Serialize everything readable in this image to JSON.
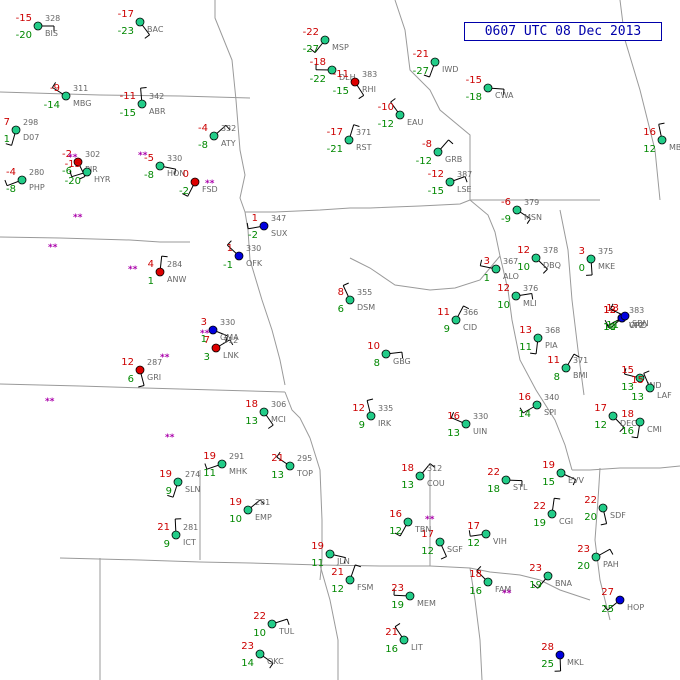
{
  "map_title": "0607 UTC 08 Dec 2013",
  "colors": {
    "temperature": "#cc0000",
    "dewpoint": "#008800",
    "station_id": "#666666",
    "pressure": "#666666",
    "weather": "#aa00aa",
    "sky_clear": "#ffffff",
    "sky_ovc_blue": "#0000dd",
    "sky_ovc_red": "#dd0000",
    "sky_ovc_green": "#22cc88",
    "border": "#999999",
    "title": "#0000aa"
  },
  "stations": [
    {
      "id": "BIS",
      "t": "-15",
      "td": "-20",
      "p": "328",
      "sky": "green"
    },
    {
      "id": "BAC",
      "t": "-17",
      "td": "-23",
      "p": "",
      "sky": "green"
    },
    {
      "id": "D07",
      "t": "7",
      "td": "1",
      "p": "298",
      "sky": "green"
    },
    {
      "id": "PHP",
      "t": "-4",
      "td": "-8",
      "p": "280",
      "sky": "green"
    },
    {
      "id": "MBG",
      "t": "-9",
      "td": "-14",
      "p": "311",
      "sky": "green"
    },
    {
      "id": "ABR",
      "t": "-11",
      "td": "-15",
      "p": "342",
      "sky": "green"
    },
    {
      "id": "ATY",
      "t": "-4",
      "td": "-8",
      "p": "332",
      "sky": "green"
    },
    {
      "id": "HON",
      "t": "-5",
      "td": "-8",
      "p": "330",
      "sky": "green"
    },
    {
      "id": "PIR",
      "t": "-2",
      "td": "-6",
      "p": "302",
      "sky": "red"
    },
    {
      "id": "FSD",
      "t": "0",
      "td": "-2",
      "p": "",
      "sky": "red"
    },
    {
      "id": "SUX",
      "t": "1",
      "td": "-2",
      "p": "347",
      "sky": "blue"
    },
    {
      "id": "OFK",
      "t": "1",
      "td": "-1",
      "p": "330",
      "sky": "blue"
    },
    {
      "id": "ANW",
      "t": "4",
      "td": "1",
      "p": "284",
      "sky": "red"
    },
    {
      "id": "LNK",
      "t": "7",
      "td": "3",
      "p": "312",
      "sky": "red"
    },
    {
      "id": "OMA",
      "t": "3",
      "td": "1",
      "p": "330",
      "sky": "blue"
    },
    {
      "id": "GRI",
      "t": "12",
      "td": "6",
      "p": "287",
      "sky": "red"
    },
    {
      "id": "MSP",
      "t": "-22",
      "td": "-27",
      "p": "",
      "sky": "green"
    },
    {
      "id": "DLH",
      "t": "-18",
      "td": "-22",
      "p": "",
      "sky": "green"
    },
    {
      "id": "EAU",
      "t": "-10",
      "td": "-12",
      "p": "",
      "sky": "green"
    },
    {
      "id": "RST",
      "t": "-17",
      "td": "-21",
      "p": "371",
      "sky": "green"
    },
    {
      "id": "LSE",
      "t": "-12",
      "td": "-15",
      "p": "387",
      "sky": "green"
    },
    {
      "id": "MSN",
      "t": "-6",
      "td": "-9",
      "p": "379",
      "sky": "green"
    },
    {
      "id": "MKE",
      "t": "3",
      "td": "0",
      "p": "375",
      "sky": "green"
    },
    {
      "id": "ORD",
      "t": "12",
      "td": "10",
      "p": "383",
      "sky": "green"
    },
    {
      "id": "ALO",
      "t": "3",
      "td": "1",
      "p": "367",
      "sky": "green"
    },
    {
      "id": "DSM",
      "t": "8",
      "td": "6",
      "p": "355",
      "sky": "green"
    },
    {
      "id": "CID",
      "t": "11",
      "td": "9",
      "p": "366",
      "sky": "green"
    },
    {
      "id": "MLI",
      "t": "12",
      "td": "10",
      "p": "376",
      "sky": "green"
    },
    {
      "id": "DBQ",
      "t": "12",
      "td": "10",
      "p": "378",
      "sky": "green"
    },
    {
      "id": "PIA",
      "t": "13",
      "td": "11",
      "p": "368",
      "sky": "green"
    },
    {
      "id": "SPI",
      "t": "16",
      "td": "14",
      "p": "340",
      "sky": "green"
    },
    {
      "id": "UIN",
      "t": "16",
      "td": "13",
      "p": "330",
      "sky": "green"
    },
    {
      "id": "IRK",
      "t": "12",
      "td": "9",
      "p": "335",
      "sky": "green"
    },
    {
      "id": "COU",
      "t": "18",
      "td": "13",
      "p": "312",
      "sky": "green"
    },
    {
      "id": "STL",
      "t": "22",
      "td": "18",
      "p": "",
      "sky": "green"
    },
    {
      "id": "MCI",
      "t": "18",
      "td": "13",
      "p": "306",
      "sky": "green"
    },
    {
      "id": "SLN",
      "t": "19",
      "td": "9",
      "p": "274",
      "sky": "green"
    },
    {
      "id": "MHK",
      "t": "19",
      "td": "11",
      "p": "291",
      "sky": "green"
    },
    {
      "id": "TOP",
      "t": "21",
      "td": "13",
      "p": "295",
      "sky": "green"
    },
    {
      "id": "ICT",
      "t": "21",
      "td": "9",
      "p": "281",
      "sky": "green"
    },
    {
      "id": "EMP",
      "t": "19",
      "td": "10",
      "p": "281",
      "sky": "green"
    },
    {
      "id": "JLN",
      "t": "19",
      "td": "11",
      "p": "",
      "sky": "green"
    },
    {
      "id": "SGF",
      "t": "17",
      "td": "12",
      "p": "",
      "sky": "green"
    },
    {
      "id": "TBN",
      "t": "16",
      "td": "12",
      "p": "",
      "sky": "green"
    },
    {
      "id": "VIH",
      "t": "17",
      "td": "12",
      "p": "",
      "sky": "green"
    },
    {
      "id": "FAM",
      "t": "18",
      "td": "16",
      "p": "",
      "sky": "green"
    },
    {
      "id": "CGI",
      "t": "22",
      "td": "19",
      "p": "",
      "sky": "green"
    },
    {
      "id": "PAH",
      "t": "23",
      "td": "20",
      "p": "",
      "sky": "green"
    },
    {
      "id": "EVV",
      "t": "19",
      "td": "15",
      "p": "",
      "sky": "green"
    },
    {
      "id": "SDF",
      "t": "22",
      "td": "20",
      "p": "",
      "sky": "green"
    },
    {
      "id": "BNA",
      "t": "23",
      "td": "19",
      "p": "",
      "sky": "green"
    },
    {
      "id": "MEM",
      "t": "23",
      "td": "19",
      "p": "",
      "sky": "green"
    },
    {
      "id": "LIT",
      "t": "21",
      "td": "16",
      "p": "",
      "sky": "green"
    },
    {
      "id": "FSM",
      "t": "21",
      "td": "12",
      "p": "",
      "sky": "green"
    },
    {
      "id": "TUL",
      "t": "22",
      "td": "10",
      "p": "",
      "sky": "green"
    },
    {
      "id": "OKC",
      "t": "23",
      "td": "14",
      "p": "",
      "sky": "green"
    },
    {
      "id": "MKL",
      "t": "28",
      "td": "25",
      "p": "",
      "sky": "blue"
    },
    {
      "id": "HOP",
      "t": "27",
      "td": "25",
      "p": "",
      "sky": "blue"
    },
    {
      "id": "IND",
      "t": "15",
      "td": "13",
      "p": "",
      "sky": "green"
    },
    {
      "id": "LAF",
      "t": "15",
      "td": "13",
      "p": "",
      "sky": "green"
    },
    {
      "id": "BMI",
      "t": "11",
      "td": "8",
      "p": "371",
      "sky": "green"
    },
    {
      "id": "GBG",
      "t": "10",
      "td": "8",
      "p": "",
      "sky": "green"
    },
    {
      "id": "DEC",
      "t": "17",
      "td": "12",
      "p": "",
      "sky": "green"
    },
    {
      "id": "CMI",
      "t": "18",
      "td": "16",
      "p": "",
      "sky": "green"
    },
    {
      "id": "VPZ",
      "t": "13",
      "td": "11",
      "p": "",
      "sky": "blue"
    },
    {
      "id": "SBN",
      "t": "13",
      "td": "11",
      "p": "",
      "sky": "blue"
    },
    {
      "id": "MBL",
      "t": "16",
      "td": "12",
      "p": "",
      "sky": "green"
    },
    {
      "id": "GRB",
      "t": "-8",
      "td": "-12",
      "p": "",
      "sky": "green"
    },
    {
      "id": "CWA",
      "t": "-15",
      "td": "-18",
      "p": "",
      "sky": "green"
    },
    {
      "id": "RHI",
      "t": "-11",
      "td": "-15",
      "p": "383",
      "sky": "red"
    },
    {
      "id": "IWD",
      "t": "-21",
      "td": "-27",
      "p": "",
      "sky": "green"
    },
    {
      "id": "HYR",
      "t": "-15",
      "td": "-20",
      "p": "",
      "sky": "green"
    }
  ],
  "weather_symbols": [
    "**",
    "**",
    "**",
    "**",
    "**",
    "**",
    "**",
    "**",
    "**",
    "**",
    "**",
    "**"
  ]
}
